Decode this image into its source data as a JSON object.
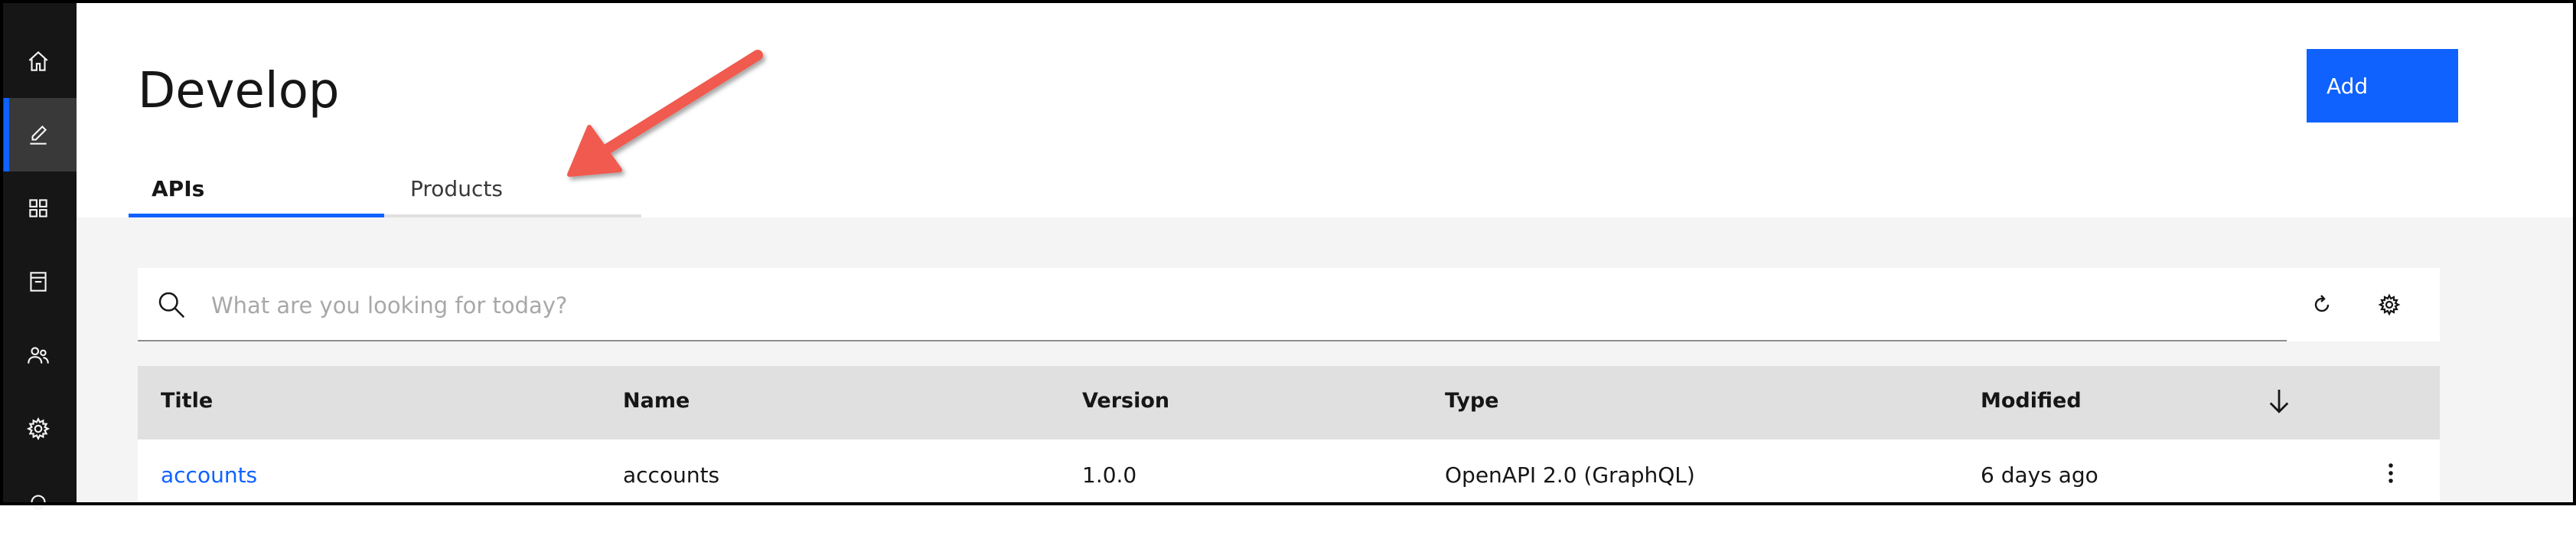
{
  "page": {
    "title": "Develop"
  },
  "header": {
    "add_label": "Add"
  },
  "sidebar": {
    "items": [
      {
        "name": "home",
        "icon": "home-icon",
        "active": false
      },
      {
        "name": "develop",
        "icon": "edit-icon",
        "active": true
      },
      {
        "name": "manage",
        "icon": "grid-icon",
        "active": false
      },
      {
        "name": "catalog",
        "icon": "archive-icon",
        "active": false
      },
      {
        "name": "members",
        "icon": "users-icon",
        "active": false
      },
      {
        "name": "settings",
        "icon": "gear-icon",
        "active": false
      }
    ]
  },
  "tabs": [
    {
      "label": "APIs",
      "selected": true
    },
    {
      "label": "Products",
      "selected": false
    }
  ],
  "search": {
    "placeholder": "What are you looking for today?",
    "value": ""
  },
  "toolbar": {
    "refresh_icon": "refresh-icon",
    "settings_icon": "gear-icon"
  },
  "table": {
    "columns": [
      "Title",
      "Name",
      "Version",
      "Type",
      "Modified"
    ],
    "sort_icon": "arrow-down-icon",
    "rows": [
      {
        "title": "accounts",
        "name": "accounts",
        "version": "1.0.0",
        "type": "OpenAPI 2.0 (GraphQL)",
        "modified": "6 days ago"
      }
    ]
  },
  "annotation": {
    "color": "#f15a4f",
    "points_to": "Products"
  },
  "colors": {
    "accent": "#0f62fe",
    "sidebar": "#161616",
    "content_bg": "#f4f4f4",
    "table_header": "#e0e0e0"
  }
}
